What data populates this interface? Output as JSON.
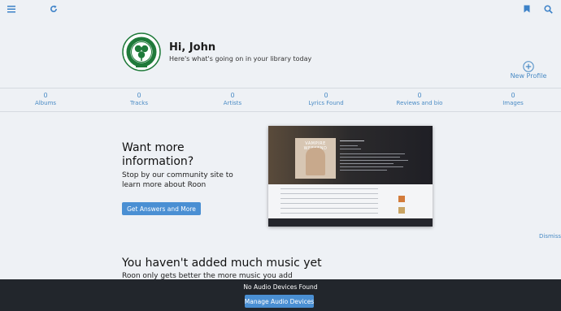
{
  "greeting": "Hi, John",
  "subtitle": "Here's what's going on in your library today",
  "new_profile_label": "New Profile",
  "stats": [
    {
      "value": "0",
      "label": "Albums"
    },
    {
      "value": "0",
      "label": "Tracks"
    },
    {
      "value": "0",
      "label": "Artists"
    },
    {
      "value": "0",
      "label": "Lyrics Found"
    },
    {
      "value": "0",
      "label": "Reviews and bio"
    },
    {
      "value": "0",
      "label": "Images"
    }
  ],
  "info_card": {
    "heading": "Want more information?",
    "body": "Stop by our community site to learn more about Roon",
    "button": "Get Answers and More",
    "preview_album_title": "VAMPIRE WEEKEND"
  },
  "dismiss_label": "Dismiss",
  "empty_library": {
    "heading": "You haven't added much music yet",
    "body": "Roon only gets better the more music you add"
  },
  "audio_bar": {
    "status": "No Audio Devices Found",
    "button": "Manage Audio Devices"
  },
  "colors": {
    "accent": "#4a8fd3",
    "link": "#4a8bc5",
    "bar": "#22262c",
    "bg": "#eef1f5",
    "crest": "#1f7a3a"
  },
  "icons": {
    "menu": "hamburger-menu-icon",
    "refresh": "refresh-icon",
    "bookmark": "bookmark-icon",
    "search": "search-icon",
    "avatar": "celtic-crest-avatar",
    "add": "plus-circle-icon"
  }
}
